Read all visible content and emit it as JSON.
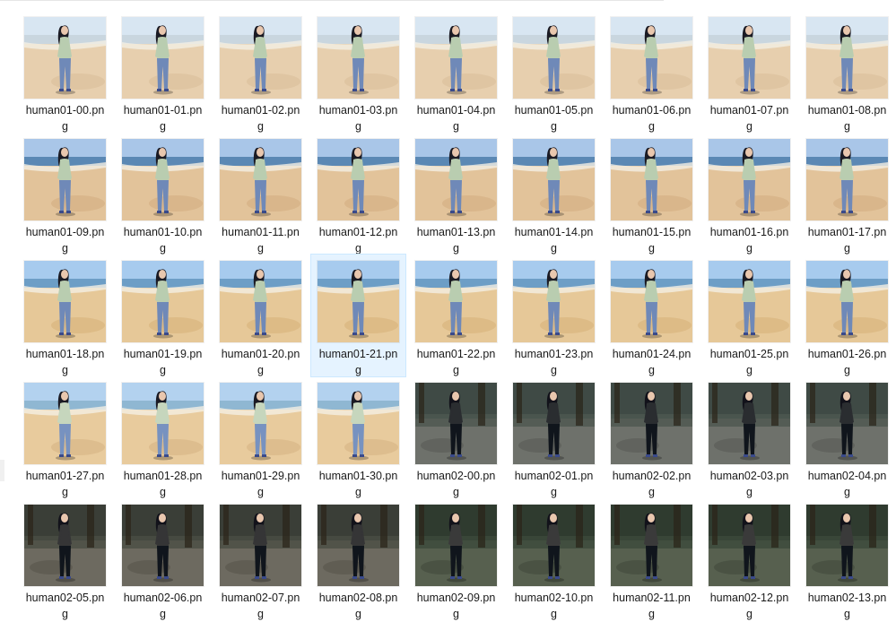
{
  "files": [
    {
      "name": "human01-00.png",
      "line1": "human01-00.pn",
      "line2": "g",
      "scene": "beach-a"
    },
    {
      "name": "human01-01.png",
      "line1": "human01-01.pn",
      "line2": "g",
      "scene": "beach-a"
    },
    {
      "name": "human01-02.png",
      "line1": "human01-02.pn",
      "line2": "g",
      "scene": "beach-a"
    },
    {
      "name": "human01-03.png",
      "line1": "human01-03.pn",
      "line2": "g",
      "scene": "beach-a"
    },
    {
      "name": "human01-04.png",
      "line1": "human01-04.pn",
      "line2": "g",
      "scene": "beach-a"
    },
    {
      "name": "human01-05.png",
      "line1": "human01-05.pn",
      "line2": "g",
      "scene": "beach-a"
    },
    {
      "name": "human01-06.png",
      "line1": "human01-06.pn",
      "line2": "g",
      "scene": "beach-a"
    },
    {
      "name": "human01-07.png",
      "line1": "human01-07.pn",
      "line2": "g",
      "scene": "beach-a"
    },
    {
      "name": "human01-08.png",
      "line1": "human01-08.pn",
      "line2": "g",
      "scene": "beach-a"
    },
    {
      "name": "human01-09.png",
      "line1": "human01-09.pn",
      "line2": "g",
      "scene": "beach-b"
    },
    {
      "name": "human01-10.png",
      "line1": "human01-10.pn",
      "line2": "g",
      "scene": "beach-b"
    },
    {
      "name": "human01-11.png",
      "line1": "human01-11.pn",
      "line2": "g",
      "scene": "beach-b"
    },
    {
      "name": "human01-12.png",
      "line1": "human01-12.pn",
      "line2": "g",
      "scene": "beach-b"
    },
    {
      "name": "human01-13.png",
      "line1": "human01-13.pn",
      "line2": "g",
      "scene": "beach-b"
    },
    {
      "name": "human01-14.png",
      "line1": "human01-14.pn",
      "line2": "g",
      "scene": "beach-b"
    },
    {
      "name": "human01-15.png",
      "line1": "human01-15.pn",
      "line2": "g",
      "scene": "beach-b"
    },
    {
      "name": "human01-16.png",
      "line1": "human01-16.pn",
      "line2": "g",
      "scene": "beach-b"
    },
    {
      "name": "human01-17.png",
      "line1": "human01-17.pn",
      "line2": "g",
      "scene": "beach-b"
    },
    {
      "name": "human01-18.png",
      "line1": "human01-18.pn",
      "line2": "g",
      "scene": "beach-c"
    },
    {
      "name": "human01-19.png",
      "line1": "human01-19.pn",
      "line2": "g",
      "scene": "beach-c"
    },
    {
      "name": "human01-20.png",
      "line1": "human01-20.pn",
      "line2": "g",
      "scene": "beach-c"
    },
    {
      "name": "human01-21.png",
      "line1": "human01-21.pn",
      "line2": "g",
      "scene": "beach-c",
      "selected": true
    },
    {
      "name": "human01-22.png",
      "line1": "human01-22.pn",
      "line2": "g",
      "scene": "beach-c"
    },
    {
      "name": "human01-23.png",
      "line1": "human01-23.pn",
      "line2": "g",
      "scene": "beach-c"
    },
    {
      "name": "human01-24.png",
      "line1": "human01-24.pn",
      "line2": "g",
      "scene": "beach-c"
    },
    {
      "name": "human01-25.png",
      "line1": "human01-25.pn",
      "line2": "g",
      "scene": "beach-c"
    },
    {
      "name": "human01-26.png",
      "line1": "human01-26.pn",
      "line2": "g",
      "scene": "beach-c"
    },
    {
      "name": "human01-27.png",
      "line1": "human01-27.pn",
      "line2": "g",
      "scene": "beach-d"
    },
    {
      "name": "human01-28.png",
      "line1": "human01-28.pn",
      "line2": "g",
      "scene": "beach-d"
    },
    {
      "name": "human01-29.png",
      "line1": "human01-29.pn",
      "line2": "g",
      "scene": "beach-d"
    },
    {
      "name": "human01-30.png",
      "line1": "human01-30.pn",
      "line2": "g",
      "scene": "beach-d"
    },
    {
      "name": "human02-00.png",
      "line1": "human02-00.pn",
      "line2": "g",
      "scene": "forest-a"
    },
    {
      "name": "human02-01.png",
      "line1": "human02-01.pn",
      "line2": "g",
      "scene": "forest-a"
    },
    {
      "name": "human02-02.png",
      "line1": "human02-02.pn",
      "line2": "g",
      "scene": "forest-a"
    },
    {
      "name": "human02-03.png",
      "line1": "human02-03.pn",
      "line2": "g",
      "scene": "forest-a"
    },
    {
      "name": "human02-04.png",
      "line1": "human02-04.pn",
      "line2": "g",
      "scene": "forest-a"
    },
    {
      "name": "human02-05.png",
      "line1": "human02-05.pn",
      "line2": "g",
      "scene": "forest-b"
    },
    {
      "name": "human02-06.png",
      "line1": "human02-06.pn",
      "line2": "g",
      "scene": "forest-b"
    },
    {
      "name": "human02-07.png",
      "line1": "human02-07.pn",
      "line2": "g",
      "scene": "forest-b"
    },
    {
      "name": "human02-08.png",
      "line1": "human02-08.pn",
      "line2": "g",
      "scene": "forest-b"
    },
    {
      "name": "human02-09.png",
      "line1": "human02-09.pn",
      "line2": "g",
      "scene": "forest-c"
    },
    {
      "name": "human02-10.png",
      "line1": "human02-10.pn",
      "line2": "g",
      "scene": "forest-c"
    },
    {
      "name": "human02-11.png",
      "line1": "human02-11.pn",
      "line2": "g",
      "scene": "forest-c"
    },
    {
      "name": "human02-12.png",
      "line1": "human02-12.pn",
      "line2": "g",
      "scene": "forest-c"
    },
    {
      "name": "human02-13.png",
      "line1": "human02-13.pn",
      "line2": "g",
      "scene": "forest-c"
    }
  ],
  "scenes": {
    "beach-a": {
      "sky": "#d8e6f2",
      "sea": "#c9d6df",
      "sand": "#e7cfae",
      "sand2": "#dcc09c",
      "top": "#b9cdb0",
      "pants": "#6f89b8",
      "hair": "#1b1b24"
    },
    "beach-b": {
      "sky": "#a9c6e8",
      "sea": "#5b88b4",
      "sand": "#e2c39a",
      "sand2": "#d6b184",
      "top": "#b9cdb0",
      "pants": "#6f89b8",
      "hair": "#1b1b24"
    },
    "beach-c": {
      "sky": "#a7cbee",
      "sea": "#6d9ec6",
      "sand": "#e6c898",
      "sand2": "#d8b57f",
      "top": "#b9cdb0",
      "pants": "#6f89b8",
      "hair": "#1b1b24"
    },
    "beach-d": {
      "sky": "#b3d2ef",
      "sea": "#8fb7d2",
      "sand": "#e8cb9d",
      "sand2": "#d9b787",
      "top": "#c6d6bd",
      "pants": "#7792c0",
      "hair": "#1b1b24"
    },
    "forest-a": {
      "sky": "#3f4a45",
      "sea": "#4d5750",
      "sand": "#6e716b",
      "sand2": "#5b5e58",
      "top": "#2a2d30",
      "pants": "#10151c",
      "hair": "#12121a"
    },
    "forest-b": {
      "sky": "#3a3e37",
      "sea": "#4a4d44",
      "sand": "#6d6a60",
      "sand2": "#5b584f",
      "top": "#353536",
      "pants": "#10151c",
      "hair": "#12121a"
    },
    "forest-c": {
      "sky": "#2f3b2f",
      "sea": "#3c4a3b",
      "sand": "#57604f",
      "sand2": "#454d3f",
      "top": "#3a3a3a",
      "pants": "#10151c",
      "hair": "#12121a"
    }
  },
  "colors": {
    "selection_bg": "#e5f3ff",
    "selection_border": "#cce8ff"
  }
}
